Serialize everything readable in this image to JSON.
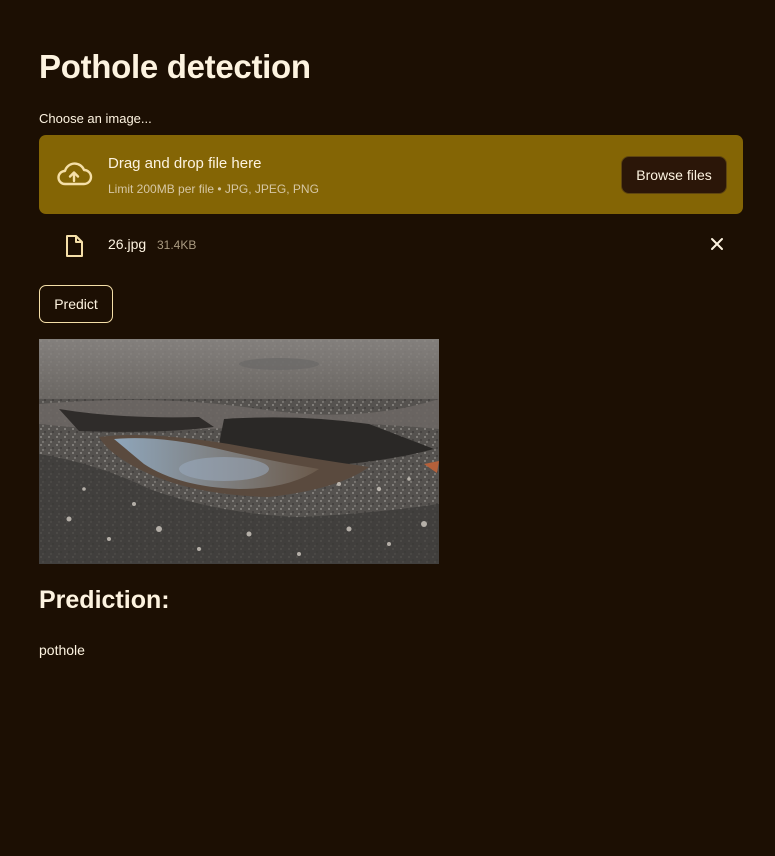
{
  "page": {
    "title": "Pothole detection"
  },
  "uploader": {
    "label": "Choose an image...",
    "drop_text": "Drag and drop file here",
    "limit_text": "Limit 200MB per file • JPG, JPEG, PNG",
    "browse_label": "Browse files",
    "icon": "cloud-upload-icon"
  },
  "file": {
    "name": "26.jpg",
    "size": "31.4KB",
    "icon": "file-icon",
    "remove_icon": "close-icon"
  },
  "actions": {
    "predict_label": "Predict"
  },
  "result": {
    "heading": "Prediction:",
    "value": "pothole"
  },
  "colors": {
    "background": "#1c0f03",
    "dropzone": "#846505",
    "text": "#fdf3e0",
    "button_border": "#f5dfa8"
  }
}
